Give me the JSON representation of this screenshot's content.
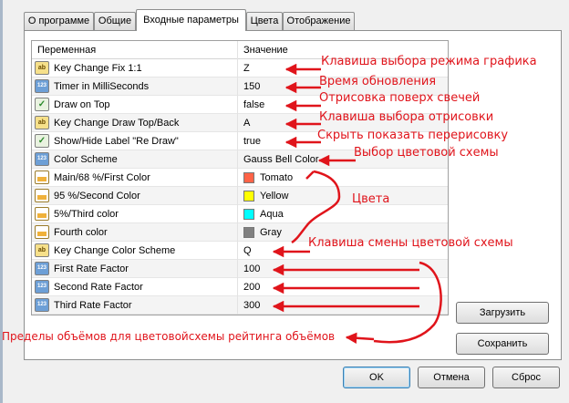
{
  "tabs": [
    {
      "label": "О программе",
      "active": false
    },
    {
      "label": "Общие",
      "active": false
    },
    {
      "label": "Входные параметры",
      "active": true
    },
    {
      "label": "Цвета",
      "active": false
    },
    {
      "label": "Отображение",
      "active": false
    }
  ],
  "grid": {
    "header": {
      "variable": "Переменная",
      "value": "Значение"
    },
    "rows": [
      {
        "icon": "ab-type-icon",
        "name": "Key Change Fix 1:1",
        "value": "Z"
      },
      {
        "icon": "number-type-icon",
        "name": "Timer in MilliSeconds",
        "value": "150"
      },
      {
        "icon": "bool-type-icon",
        "name": "Draw on Top",
        "value": "false"
      },
      {
        "icon": "ab-type-icon",
        "name": "Key Change Draw Top/Back",
        "value": "A"
      },
      {
        "icon": "bool-type-icon",
        "name": "Show/Hide Label \"Re Draw\"",
        "value": "true"
      },
      {
        "icon": "number-type-icon",
        "name": "Color Scheme",
        "value": "Gauss Bell Color"
      },
      {
        "icon": "color-type-icon",
        "name": "Main/68 %/First Color",
        "value": "Tomato",
        "swatch": "#ff6347"
      },
      {
        "icon": "color-type-icon",
        "name": "95 %/Second Color",
        "value": "Yellow",
        "swatch": "#ffff00"
      },
      {
        "icon": "color-type-icon",
        "name": "5%/Third color",
        "value": "Aqua",
        "swatch": "#00ffff"
      },
      {
        "icon": "color-type-icon",
        "name": "Fourth color",
        "value": "Gray",
        "swatch": "#808080"
      },
      {
        "icon": "ab-type-icon",
        "name": "Key Change Color Scheme",
        "value": "Q"
      },
      {
        "icon": "number-type-icon",
        "name": "First Rate Factor",
        "value": "100"
      },
      {
        "icon": "number-type-icon",
        "name": "Second Rate Factor",
        "value": "200"
      },
      {
        "icon": "number-type-icon",
        "name": "Third Rate Factor",
        "value": "300"
      }
    ]
  },
  "side_buttons": {
    "load": "Загрузить",
    "save": "Сохранить"
  },
  "footer_buttons": {
    "ok": "OK",
    "cancel": "Отмена",
    "reset": "Сброс"
  },
  "annotations": {
    "fix_key": "Клавиша выбора режима графика",
    "timer": "Время обновления",
    "draw_top": "Отрисовка поверх свечей",
    "draw_key": "Клавиша выбора отрисовки",
    "show_label": "Скрыть показать перерисовку",
    "color_scheme": "Выбор цветовой схемы",
    "colors": "Цвета",
    "scheme_key": "Клавиша смены цветовой схемы",
    "rate_limits": "Пределы объёмов для цветовойсхемы рейтинга объёмов"
  },
  "colors": {
    "annotation": "#e0141b",
    "accent_border": "#3c7fb1"
  }
}
